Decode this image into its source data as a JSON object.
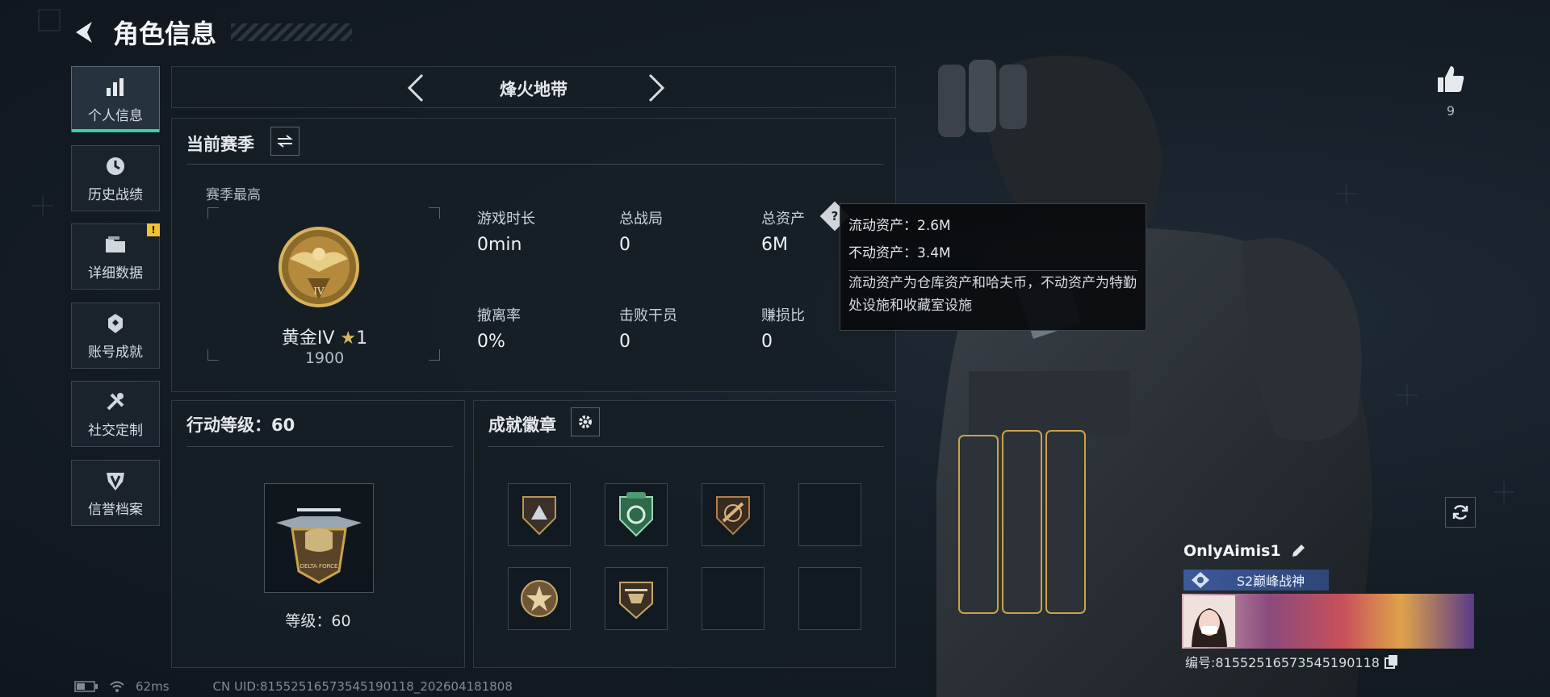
{
  "header": {
    "title": "角色信息"
  },
  "nav": [
    {
      "label": "个人信息",
      "icon": "bar-chart-icon",
      "active": true
    },
    {
      "label": "历史战绩",
      "icon": "clock-icon"
    },
    {
      "label": "详细数据",
      "icon": "folder-icon",
      "alert": "!"
    },
    {
      "label": "账号成就",
      "icon": "achievement-icon"
    },
    {
      "label": "社交定制",
      "icon": "tools-icon"
    },
    {
      "label": "信誉档案",
      "icon": "shield-emblem-icon"
    }
  ],
  "mode": {
    "title": "烽火地带"
  },
  "season": {
    "title": "当前赛季",
    "best_label": "赛季最高",
    "rank_name": "黄金IV",
    "rank_stars": "1",
    "rank_emblem_numeral": "IV",
    "rank_score": "1900",
    "stats": [
      {
        "label": "游戏时长",
        "value": "0min"
      },
      {
        "label": "总战局",
        "value": "0"
      },
      {
        "label": "总资产",
        "value": "6M",
        "has_help": true
      },
      {
        "label": "撤离率",
        "value": "0%"
      },
      {
        "label": "击败干员",
        "value": "0"
      },
      {
        "label": "赚损比",
        "value": "0"
      }
    ]
  },
  "tooltip": {
    "liquid": "流动资产：2.6M",
    "fixed": "不动资产：3.4M",
    "desc": "流动资产为仓库资产和哈夫币，不动资产为特勤处设施和收藏室设施"
  },
  "action_level": {
    "title": "行动等级：60",
    "level_text": "等级：60",
    "emblem_text": "DELTA FORCE"
  },
  "badges": {
    "title": "成就徽章"
  },
  "likes": {
    "count": "9"
  },
  "profile": {
    "name": "OnlyAimis1",
    "title": "S2巅峰战神",
    "id_text": "编号:8155251657354519011​8"
  },
  "status": {
    "ping": "62ms",
    "uid": "CN UID:8155251657354519011​8_202604181808"
  },
  "colors": {
    "accent": "#2fd3a6",
    "gold": "#c9a24a"
  }
}
